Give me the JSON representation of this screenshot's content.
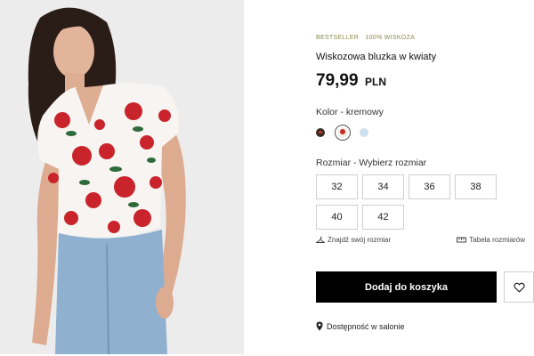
{
  "product": {
    "badges": [
      "BESTSELLER",
      "100% WISKOZA"
    ],
    "title": "Wiskozowa bluzka w kwiaty",
    "price": "79,99",
    "currency": "PLN"
  },
  "color": {
    "label": "Kolor - kremowy",
    "swatches": [
      {
        "icon": "dark-print-swatch",
        "color": "#3a2a25",
        "selected": false
      },
      {
        "icon": "cream-floral-swatch",
        "color": "#f3eee8",
        "selected": true
      },
      {
        "icon": "light-blue-swatch",
        "color": "#cfe0f0",
        "selected": false
      }
    ]
  },
  "size": {
    "label": "Rozmiar - Wybierz rozmiar",
    "options": [
      "32",
      "34",
      "36",
      "38",
      "40",
      "42"
    ]
  },
  "helpers": {
    "find_size": "Znajdź swój rozmiar",
    "size_table": "Tabela rozmiarów"
  },
  "actions": {
    "add_to_cart": "Dodaj do koszyka",
    "wishlist_icon": "heart-icon"
  },
  "availability": {
    "label": "Dostępność w salonie",
    "icon": "location-pin-icon"
  }
}
